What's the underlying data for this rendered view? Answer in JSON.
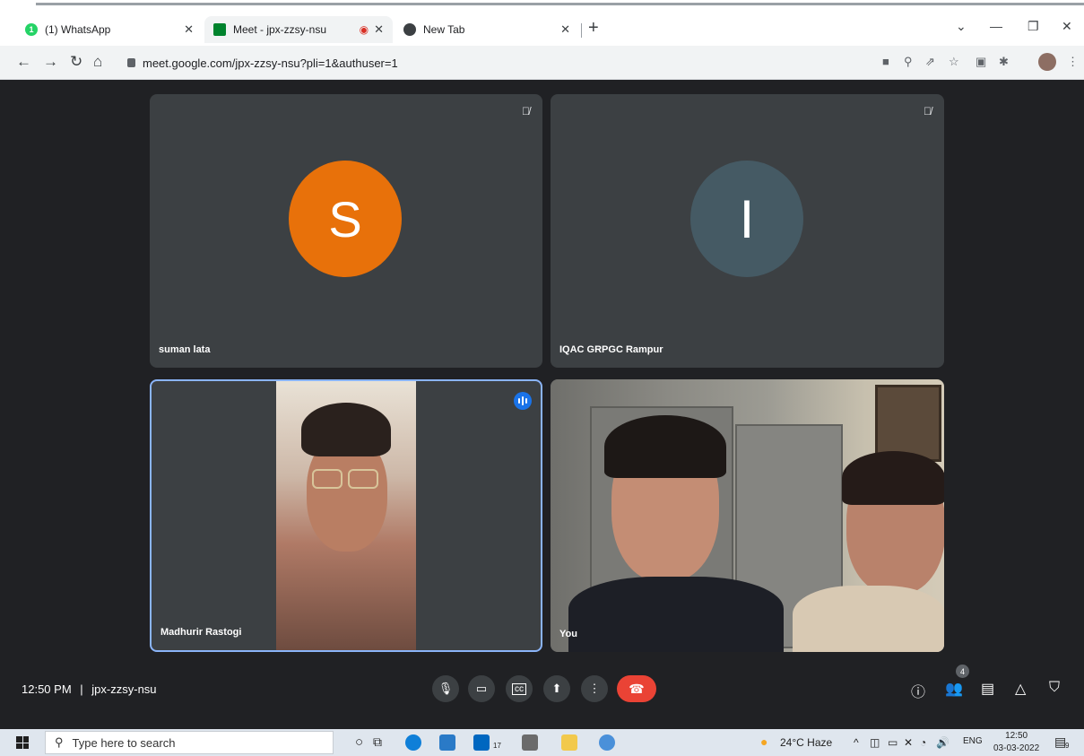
{
  "browser": {
    "tabs": [
      {
        "label": "(1) WhatsApp",
        "favicon": "whatsapp-icon"
      },
      {
        "label": "Meet - jpx-zzsy-nsu",
        "favicon": "meet-icon",
        "recording": true
      },
      {
        "label": "New Tab",
        "favicon": "chrome-icon"
      }
    ],
    "url": "meet.google.com/jpx-zzsy-nsu?pli=1&authuser=1"
  },
  "meet": {
    "participants": [
      {
        "name": "suman lata",
        "initial": "S",
        "avatar_color": "#e8710a",
        "muted": true
      },
      {
        "name": "IQAC GRPGC Rampur",
        "initial": "I",
        "avatar_color": "#455a64",
        "muted": true
      },
      {
        "name": "Madhurir Rastogi",
        "speaking": true
      },
      {
        "name": "You"
      }
    ],
    "time": "12:50 PM",
    "separator": "|",
    "meeting_code": "jpx-zzsy-nsu",
    "participant_count": "4"
  },
  "taskbar": {
    "search_placeholder": "Type here to search",
    "store_badge": "17",
    "weather": "24°C  Haze",
    "language": "ENG",
    "time": "12:50",
    "date": "03-03-2022",
    "notifications": "9"
  },
  "colors": {
    "meet_bg": "#202124",
    "tile_bg": "#3c4043",
    "end_call": "#ea4335",
    "accent": "#1a73e8"
  }
}
